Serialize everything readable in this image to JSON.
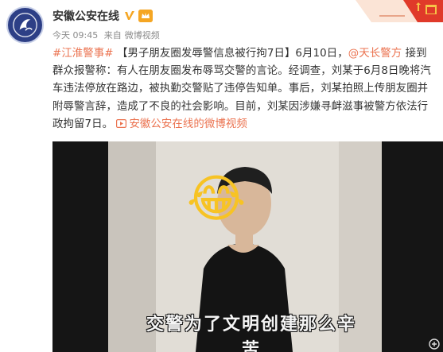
{
  "author": {
    "name": "安徽公安在线",
    "member_badge": "VIP"
  },
  "meta": {
    "time": "今天 09:45",
    "source_prefix": "来自",
    "source": "微博视频"
  },
  "post": {
    "topic": "#江淮警事#",
    "text_1": " 【男子朋友圈发辱警信息被行拘7日】6月10日，",
    "mention": "@天长警方",
    "text_2": " 接到群众报警称：有人在朋友圈发布辱骂交警的言论。经调查，刘某于6月8日晚将汽车违法停放在路边，被执勤交警贴了违停告知单。事后，刘某拍照上传朋友圈并附辱警言辞，造成了不良的社会影响。目前，刘某因涉嫌寻衅滋事被警方依法行政拘留7日。",
    "link_text": "安徽公安在线的微博视频"
  },
  "video": {
    "caption": "交警为了文明创建那么辛苦",
    "emoji": "😂"
  },
  "colors": {
    "accent": "#eb7350",
    "verified": "#f5a623",
    "avatar_bg": "#2d3f86"
  },
  "icons": [
    "avatar-logo",
    "verified-icon",
    "member-icon",
    "link-video-icon",
    "banner-flag",
    "watermark-logo-icon"
  ]
}
